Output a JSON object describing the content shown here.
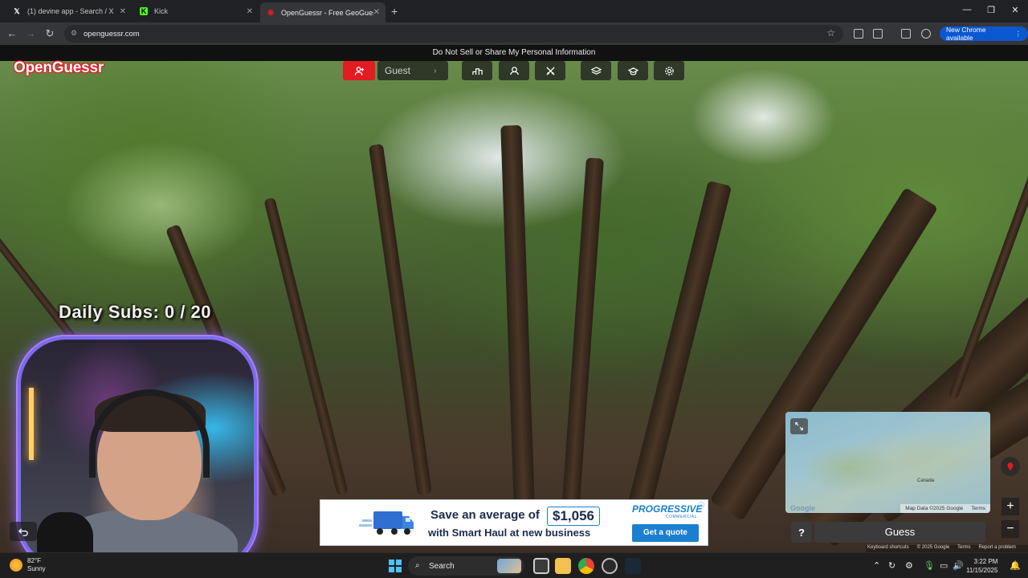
{
  "browser": {
    "tabs": [
      {
        "title": "(1) devine app - Search / X",
        "icon": "x-logo-icon"
      },
      {
        "title": "Kick",
        "icon": "kick-logo-icon"
      },
      {
        "title": "OpenGuessr - Free GeoGuessr /",
        "icon": "openguessr-logo-icon",
        "active": true
      }
    ],
    "url": "openguessr.com",
    "new_chrome_label": "New Chrome available"
  },
  "page": {
    "privacy_notice": "Do Not Sell or Share My Personal Information",
    "logo_text": "OpenGuessr",
    "toolbar": {
      "user_name": "Guest",
      "icons": [
        "user-add-icon",
        "podium-icon",
        "multiplayer-icon",
        "swords-icon",
        "layers-icon",
        "graduation-icon",
        "gear-icon"
      ]
    },
    "overlay": {
      "daily_subs": "Daily Subs:  0 / 20"
    },
    "map": {
      "place_label": "Canada",
      "attribution": "Map Data ©2025 Google",
      "terms": "Terms",
      "keyboard_shortcuts": "Keyboard shortcuts",
      "copyright": "© 2025 Google",
      "terms2": "Terms",
      "report": "Report a problem",
      "google_logo": "Google"
    },
    "guess": {
      "help_label": "?",
      "button_label": "Guess"
    },
    "ad": {
      "line1": "Save an average of",
      "price": "$1,056",
      "line2": "with Smart Haul at new business",
      "brand": "PROGRESSIVE",
      "brand_sub": "COMMERCIAL",
      "cta": "Get a quote"
    },
    "colors": {
      "accent_red": "#e31b23",
      "ad_blue": "#1a7fd0"
    }
  },
  "taskbar": {
    "weather_temp": "82°F",
    "weather_desc": "Sunny",
    "search_placeholder": "Search",
    "time": "3:22 PM",
    "date": "11/15/2025"
  }
}
